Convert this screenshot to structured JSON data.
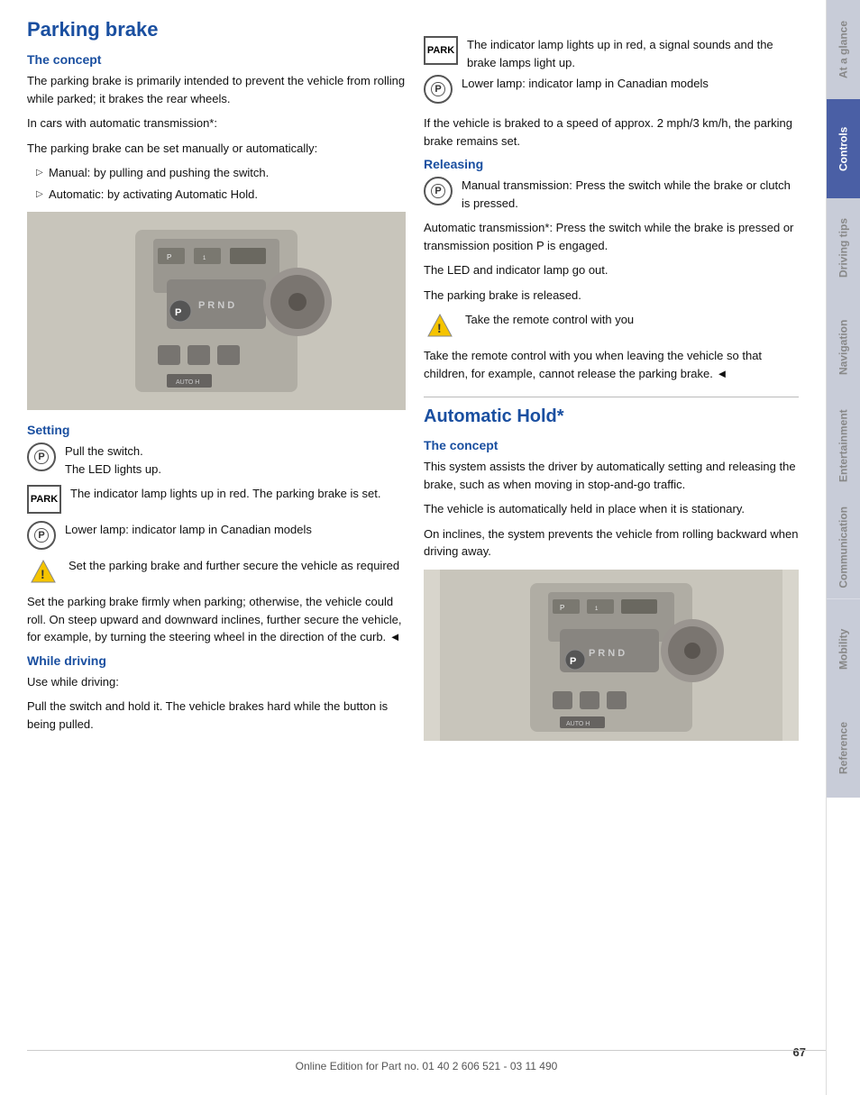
{
  "page": {
    "title": "Parking brake",
    "footer": "Online Edition for Part no. 01 40 2 606 521 - 03 11 490",
    "page_number": "67"
  },
  "sections": {
    "concept_label": "The concept",
    "concept_text1": "The parking brake is primarily intended to prevent the vehicle from rolling while parked; it brakes the rear wheels.",
    "concept_text2": "In cars with automatic transmission*:",
    "concept_text3": "The parking brake can be set manually or automatically:",
    "concept_bullet1": "Manual: by pulling and pushing the switch.",
    "concept_bullet2": "Automatic: by activating Automatic Hold.",
    "setting_label": "Setting",
    "setting_text1": "Pull the switch.",
    "setting_text2": "The LED lights up.",
    "setting_text3": "The indicator lamp lights up in red. The parking brake is set.",
    "setting_text4": "Lower lamp: indicator lamp in Canadian models",
    "setting_warning": "Set the parking brake and further secure the vehicle as required",
    "setting_text5": "Set the parking brake firmly when parking; otherwise, the vehicle could roll. On steep upward and downward inclines, further secure the vehicle, for example, by turning the steering wheel in the direction of the curb.",
    "while_driving_label": "While driving",
    "while_driving_text1": "Use while driving:",
    "while_driving_text2": "Pull the switch and hold it. The vehicle brakes hard while the button is being pulled.",
    "right_indicator_text1": "The indicator lamp lights up in red, a signal sounds and the brake lamps light up.",
    "right_indicator_text2": "Lower lamp: indicator lamp in Canadian models",
    "right_speed_text": "If the vehicle is braked to a speed of approx. 2 mph/3 km/h, the parking brake remains set.",
    "releasing_label": "Releasing",
    "releasing_text1": "Manual transmission: Press the switch while the brake or clutch is pressed.",
    "releasing_text2": "Automatic transmission*: Press the switch while the brake is pressed or transmission position P is engaged.",
    "releasing_text3": "The LED and indicator lamp go out.",
    "releasing_text4": "The parking brake is released.",
    "releasing_warning": "Take the remote control with you",
    "releasing_warning2": "Take the remote control with you when leaving the vehicle so that children, for example, cannot release the parking brake.",
    "auto_hold_label": "Automatic Hold*",
    "auto_hold_concept_label": "The concept",
    "auto_hold_text1": "This system assists the driver by automatically setting and releasing the brake, such as when moving in stop-and-go traffic.",
    "auto_hold_text2": "The vehicle is automatically held in place when it is stationary.",
    "auto_hold_text3": "On inclines, the system prevents the vehicle from rolling backward when driving away."
  },
  "sidebar": {
    "tabs": [
      {
        "label": "At a glance",
        "active": false
      },
      {
        "label": "Controls",
        "active": true
      },
      {
        "label": "Driving tips",
        "active": false
      },
      {
        "label": "Navigation",
        "active": false
      },
      {
        "label": "Entertainment",
        "active": false
      },
      {
        "label": "Communication",
        "active": false
      },
      {
        "label": "Mobility",
        "active": false
      },
      {
        "label": "Reference",
        "active": false
      }
    ]
  }
}
